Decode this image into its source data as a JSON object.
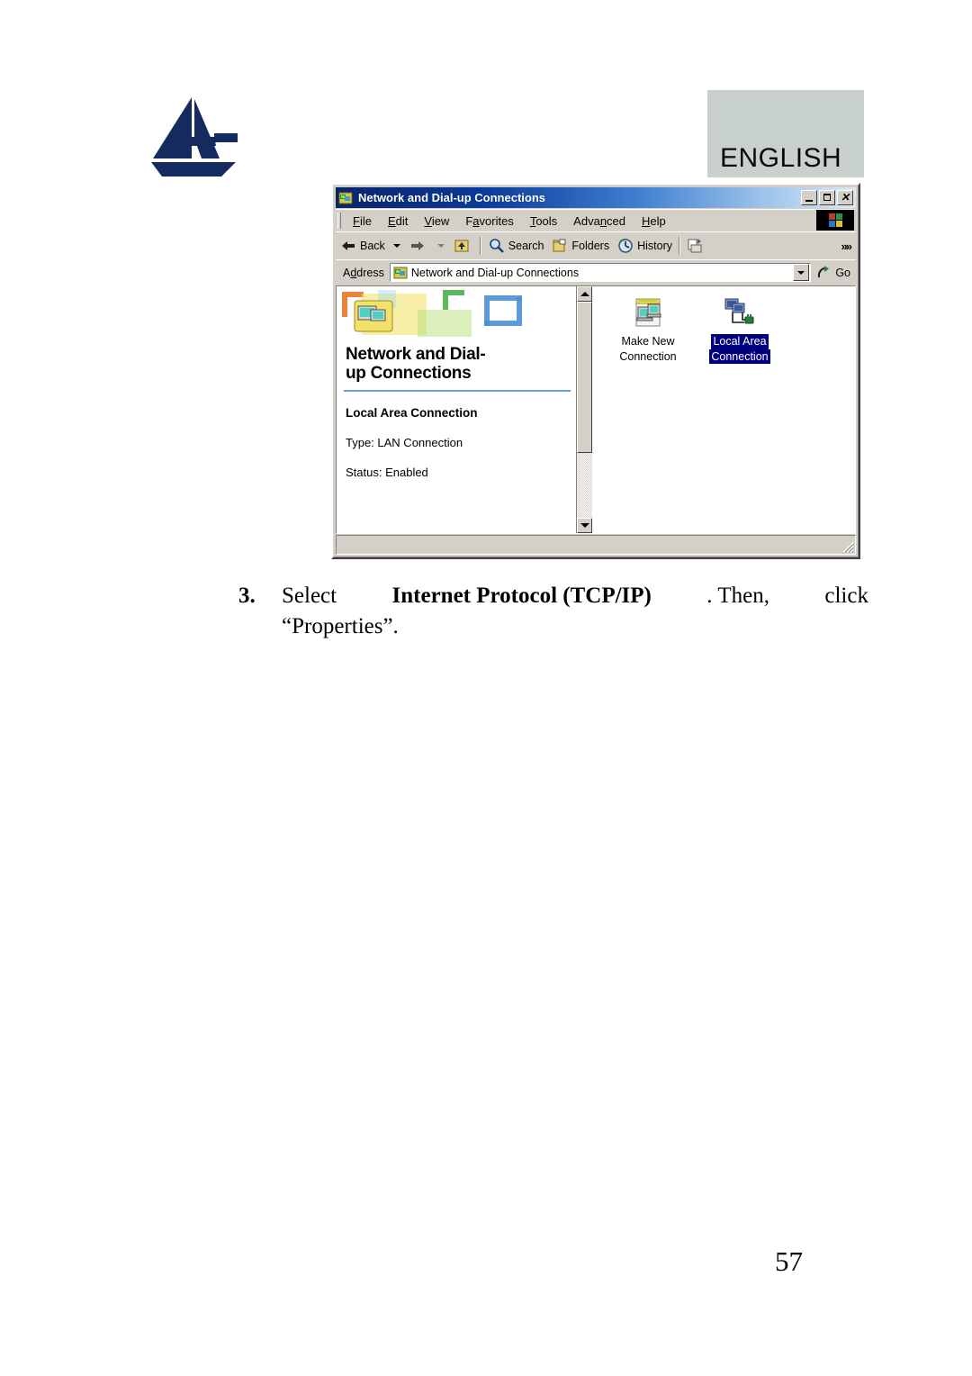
{
  "page": {
    "language_tab": "ENGLISH",
    "page_number": "57",
    "logo_name": "atlantis-land-logo"
  },
  "window": {
    "title": "Network and Dial-up Connections",
    "title_icon": "network-connections-icon",
    "controls": {
      "minimize": "minimize-button",
      "maximize": "maximize-button",
      "close": "close-button",
      "close_glyph": "✕"
    },
    "menu": [
      {
        "label": "File",
        "accel": "F"
      },
      {
        "label": "Edit",
        "accel": "E"
      },
      {
        "label": "View",
        "accel": "V"
      },
      {
        "label": "Favorites",
        "accel": "a"
      },
      {
        "label": "Tools",
        "accel": "T"
      },
      {
        "label": "Advanced",
        "accel": "n"
      },
      {
        "label": "Help",
        "accel": "H"
      }
    ],
    "toolbar": {
      "back": "Back",
      "forward_icon": "forward-arrow-icon",
      "up_icon": "up-one-level-icon",
      "search": "Search",
      "folders": "Folders",
      "history": "History",
      "move_to_icon": "move-to-folder-icon",
      "overflow": "»»"
    },
    "address": {
      "label": "Address",
      "value": "Network and Dial-up Connections",
      "icon": "network-connections-icon",
      "go_label": "Go"
    },
    "left_panel": {
      "banner_icon": "network-folder-banner-icon",
      "heading_line1": "Network and Dial-",
      "heading_line2": "up Connections",
      "selected_name": "Local Area Connection",
      "detail_type": "Type: LAN Connection",
      "detail_status": "Status: Enabled"
    },
    "items": [
      {
        "label_line1": "Make New",
        "label_line2": "Connection",
        "icon": "make-new-connection-icon",
        "selected": false
      },
      {
        "label_line1": "Local Area",
        "label_line2": "Connection",
        "icon": "local-area-connection-icon",
        "selected": true
      }
    ],
    "statusbar_text": ""
  },
  "instruction": {
    "number": "3.",
    "part1": "Select",
    "bold_part": "Internet Protocol (TCP/IP)",
    "part2": ". Then,",
    "part3": "click",
    "line2": "“Properties”."
  },
  "colors": {
    "titlebar_start": "#0a246a",
    "titlebar_end": "#dce8f5",
    "window_face": "#d4d0c8",
    "selection": "#00007f",
    "panel_rule": "#6f9fd0",
    "english_tab": "#c9d1cd",
    "logo_navy": "#152a5e"
  }
}
